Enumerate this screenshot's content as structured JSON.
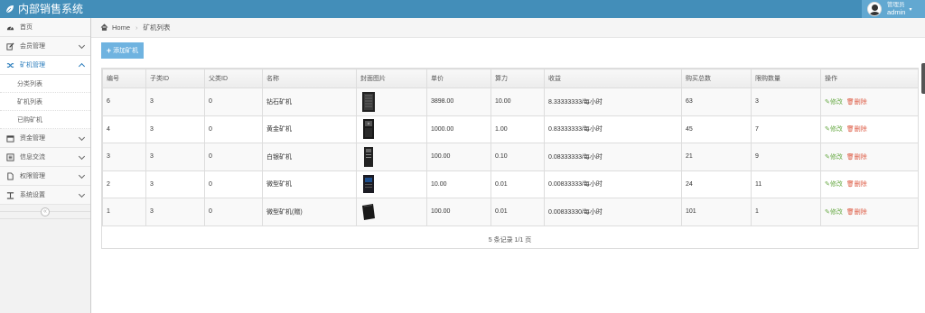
{
  "app": {
    "title": "内部销售系统",
    "user_role": "管理员",
    "user_name": "admin"
  },
  "sidebar": {
    "items": [
      {
        "label": "首页",
        "icon": "dashboard-icon"
      },
      {
        "label": "会员管理",
        "icon": "edit-icon"
      },
      {
        "label": "矿机管理",
        "icon": "random-icon",
        "active": true
      },
      {
        "label": "资金管理",
        "icon": "calendar-icon"
      },
      {
        "label": "信息交流",
        "icon": "list-icon"
      },
      {
        "label": "权限管理",
        "icon": "file-icon"
      },
      {
        "label": "系统设置",
        "icon": "text-width-icon"
      }
    ],
    "sub_items": [
      "分类列表",
      "矿机列表",
      "已购矿机"
    ]
  },
  "breadcrumb": {
    "home": "Home",
    "current": "矿机列表"
  },
  "toolbar": {
    "add_label": "添加矿机"
  },
  "table": {
    "headers": [
      "编号",
      "子类ID",
      "父类ID",
      "名称",
      "封面图片",
      "单价",
      "算力",
      "收益",
      "购买总数",
      "限购数量",
      "操作"
    ],
    "rows": [
      [
        "6",
        "3",
        "0",
        "钻石矿机",
        "",
        "3898.00",
        "10.00",
        "8.33333333/每小时",
        "63",
        "3"
      ],
      [
        "4",
        "3",
        "0",
        "黄金矿机",
        "",
        "1000.00",
        "1.00",
        "0.83333333/每小时",
        "45",
        "7"
      ],
      [
        "3",
        "3",
        "0",
        "白银矿机",
        "",
        "100.00",
        "0.10",
        "0.08333333/每小时",
        "21",
        "9"
      ],
      [
        "2",
        "3",
        "0",
        "微型矿机",
        "",
        "10.00",
        "0.01",
        "0.00833333/每小时",
        "24",
        "11"
      ],
      [
        "1",
        "3",
        "0",
        "微型矿机(赠)",
        "",
        "100.00",
        "0.01",
        "0.00833330/每小时",
        "101",
        "1"
      ]
    ],
    "edit_label": "修改",
    "delete_label": "删除"
  },
  "pager": {
    "text": "5 条记录 1/1 页"
  },
  "colors": {
    "navbar": "#438eb9",
    "accent": "#2b7dbc",
    "add_button": "#6fb3e0",
    "edit": "#69aa46",
    "delete": "#dd5a43"
  }
}
